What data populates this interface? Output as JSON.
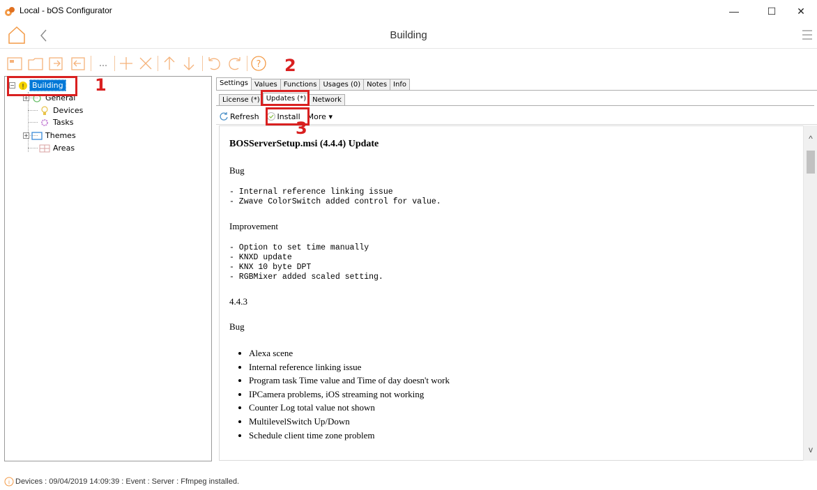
{
  "window": {
    "title": "Local - bOS Configurator",
    "min": "—",
    "max": "☐",
    "close": "✕"
  },
  "header": {
    "title": "Building"
  },
  "tree": {
    "root": "Building",
    "items": [
      "General",
      "Devices",
      "Tasks",
      "Themes",
      "Areas"
    ]
  },
  "tabs": [
    "Settings",
    "Values",
    "Functions",
    "Usages (0)",
    "Notes",
    "Info"
  ],
  "subtabs": [
    "License (*)",
    "Updates (*)",
    "Network"
  ],
  "actions": {
    "refresh": "Refresh",
    "install": "Install",
    "more": "More ▾"
  },
  "content": {
    "heading": "BOSServerSetup.msi (4.4.4) Update",
    "bug_label": "Bug",
    "bug_lines": "- Internal reference linking issue\n- Zwave ColorSwitch added control for value.",
    "improvement_label": "Improvement",
    "improvement_lines": "- Option to set time manually\n- KNXD update\n- KNX 10 byte DPT\n- RGBMixer added scaled setting.",
    "version": "4.4.3",
    "bug_label2": "Bug",
    "bullets": [
      "Alexa scene",
      "Internal reference linking issue",
      "Program task Time value and Time of day doesn't work",
      "IPCamera problems, iOS streaming not working",
      "Counter Log total value not shown",
      "MultilevelSwitch Up/Down",
      "Schedule client time zone problem"
    ]
  },
  "scroll": {
    "up": "^",
    "down": "v"
  },
  "status": {
    "text": "Devices : 09/04/2019 14:09:39 : Event : Server : Ffmpeg installed."
  },
  "annotations": {
    "n1": "1",
    "n2": "2",
    "n3": "3"
  },
  "colors": {
    "accent": "#f39a46",
    "selection": "#0078d7",
    "annotation": "#d92020"
  }
}
